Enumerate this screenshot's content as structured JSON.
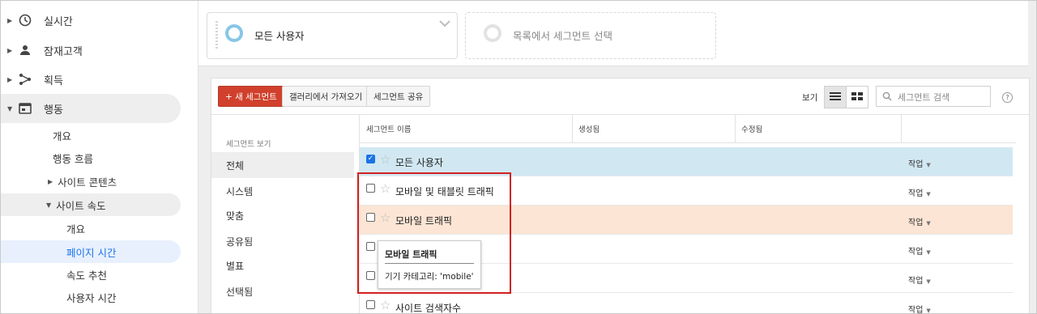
{
  "sidebar": {
    "top_items": [
      {
        "label": "실시간",
        "icon": "clock-icon"
      },
      {
        "label": "잠재고객",
        "icon": "person-icon"
      },
      {
        "label": "획득",
        "icon": "acquisition-icon"
      },
      {
        "label": "행동",
        "icon": "behavior-icon"
      }
    ],
    "behavior_children": [
      "개요",
      "행동 흐름",
      "사이트 콘텐츠",
      "사이트 속도"
    ],
    "site_speed_children": [
      "개요",
      "페이지 시간",
      "속도 추천",
      "사용자 시간"
    ]
  },
  "segments_bar": {
    "selected_segment": "모든 사용자",
    "placeholder_segment": "목록에서 세그먼트 선택"
  },
  "toolbar": {
    "new_segment": "+ 새 세그먼트",
    "import_gallery": "갤러리에서 가져오기",
    "share_segment": "세그먼트 공유",
    "view_label": "보기",
    "search_placeholder": "세그먼트 검색",
    "help": "?"
  },
  "filters": {
    "heading": "세그먼트 보기",
    "items": [
      "전체",
      "시스템",
      "맞춤",
      "공유됨",
      "별표",
      "선택됨"
    ],
    "selected": "전체"
  },
  "table": {
    "columns": [
      "세그먼트 이름",
      "생성됨",
      "수정됨"
    ],
    "action_label": "작업",
    "rows": [
      {
        "name": "모든 사용자",
        "checked": true
      },
      {
        "name": "모바일 및 태블릿 트래픽",
        "checked": false
      },
      {
        "name": "모바일 트래픽",
        "checked": false
      },
      {
        "name": "",
        "checked": false
      },
      {
        "name": "",
        "checked": false
      },
      {
        "name": "사이트 검색자수",
        "checked": false
      }
    ]
  },
  "tooltip": {
    "title": "모바일 트래픽",
    "condition": "기기 카테고리: 'mobile'"
  },
  "colors": {
    "accent_blue": "#1a73e8",
    "new_segment_red": "#d0402c",
    "selected_row": "#d1e8f3",
    "hover_row": "#fce5d4",
    "highlight_box": "#d32020"
  }
}
